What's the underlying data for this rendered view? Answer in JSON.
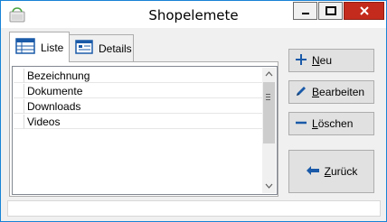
{
  "window": {
    "title": "Shopelemete",
    "controls": [
      "minimize",
      "maximize",
      "close"
    ]
  },
  "tabs": [
    {
      "label": "Liste",
      "icon": "grid-list-icon",
      "active": true
    },
    {
      "label": "Details",
      "icon": "details-card-icon",
      "active": false
    }
  ],
  "list": {
    "items": [
      "Bezeichnung",
      "Dokumente",
      "Downloads",
      "Videos"
    ]
  },
  "buttons": {
    "neu": {
      "prefix": "",
      "accel": "N",
      "rest": "eu"
    },
    "bearbeiten": {
      "prefix": "",
      "accel": "B",
      "rest": "earbeiten"
    },
    "loeschen": {
      "prefix": "",
      "accel": "L",
      "rest": "öschen"
    },
    "zurueck": {
      "prefix": "",
      "accel": "Z",
      "rest": "urück"
    }
  },
  "status": {
    "text": ""
  },
  "colors": {
    "accent_blue": "#1a5aa8",
    "close_red": "#c42b1c",
    "window_border": "#1883d7"
  }
}
